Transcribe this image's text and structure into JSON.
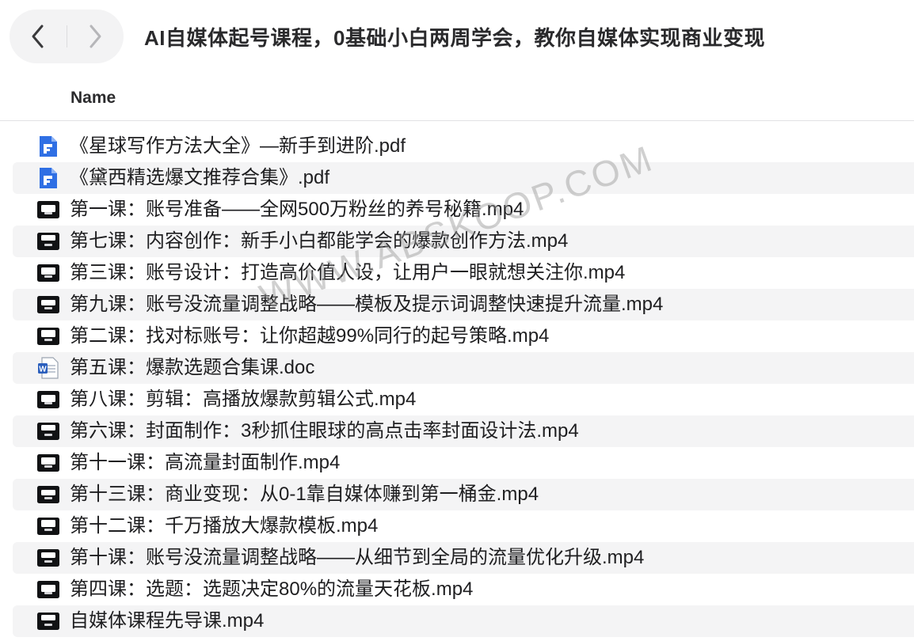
{
  "toolbar": {
    "title": "AI自媒体起号课程，0基础小白两周学会，教你自媒体实现商业变现",
    "back_icon": "chevron-left-icon",
    "forward_icon": "chevron-right-icon"
  },
  "columns": {
    "name_header": "Name"
  },
  "files": [
    {
      "name": "《星球写作方法大全》—新手到进阶.pdf",
      "type": "pdf",
      "icon": "pdf-file-icon"
    },
    {
      "name": "《黛西精选爆文推荐合集》.pdf",
      "type": "pdf",
      "icon": "pdf-file-icon"
    },
    {
      "name": "第一课：账号准备——全网500万粉丝的养号秘籍.mp4",
      "type": "mp4",
      "icon": "video-thumbnail-icon"
    },
    {
      "name": "第七课：内容创作：新手小白都能学会的爆款创作方法.mp4",
      "type": "mp4",
      "icon": "video-thumbnail-icon"
    },
    {
      "name": "第三课：账号设计：打造高价值人设，让用户一眼就想关注你.mp4",
      "type": "mp4",
      "icon": "video-thumbnail-icon"
    },
    {
      "name": "第九课：账号没流量调整战略——模板及提示词调整快速提升流量.mp4",
      "type": "mp4",
      "icon": "video-thumbnail-icon"
    },
    {
      "name": "第二课：找对标账号：让你超越99%同行的起号策略.mp4",
      "type": "mp4",
      "icon": "video-thumbnail-icon"
    },
    {
      "name": "第五课：爆款选题合集课.doc",
      "type": "doc",
      "icon": "word-doc-icon"
    },
    {
      "name": "第八课：剪辑：高播放爆款剪辑公式.mp4",
      "type": "mp4",
      "icon": "video-thumbnail-icon"
    },
    {
      "name": "第六课：封面制作：3秒抓住眼球的高点击率封面设计法.mp4",
      "type": "mp4",
      "icon": "video-thumbnail-icon"
    },
    {
      "name": "第十一课：高流量封面制作.mp4",
      "type": "mp4",
      "icon": "video-thumbnail-icon"
    },
    {
      "name": "第十三课：商业变现：从0-1靠自媒体赚到第一桶金.mp4",
      "type": "mp4",
      "icon": "video-thumbnail-icon"
    },
    {
      "name": "第十二课：千万播放大爆款模板.mp4",
      "type": "mp4",
      "icon": "video-thumbnail-icon"
    },
    {
      "name": "第十课：账号没流量调整战略——从细节到全局的流量优化升级.mp4",
      "type": "mp4",
      "icon": "video-thumbnail-icon"
    },
    {
      "name": "第四课：选题：选题决定80%的流量天花板.mp4",
      "type": "mp4",
      "icon": "video-thumbnail-icon"
    },
    {
      "name": "自媒体课程先导课.mp4",
      "type": "mp4",
      "icon": "video-thumbnail-icon"
    }
  ],
  "watermark": "WWW.ABSKOOP.COM",
  "colors": {
    "pdf_icon": "#2f6fe4",
    "doc_icon": "#2b5fbd",
    "alt_row": "#f4f4f5",
    "nav_pill": "#f3f3f4"
  }
}
